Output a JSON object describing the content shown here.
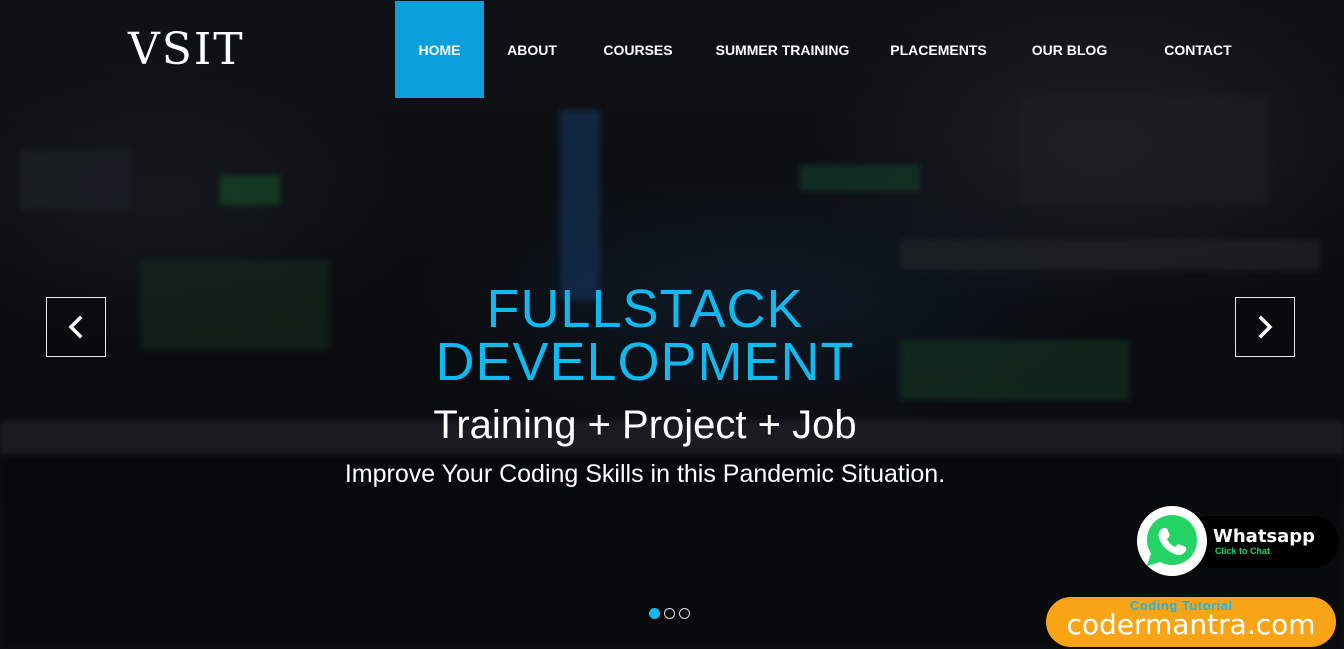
{
  "brand": {
    "logo_text": "VSIT"
  },
  "nav": {
    "items": [
      {
        "label": "HOME",
        "active": true
      },
      {
        "label": "ABOUT",
        "active": false
      },
      {
        "label": "COURSES",
        "active": false
      },
      {
        "label": "SUMMER TRAINING",
        "active": false
      },
      {
        "label": "PLACEMENTS",
        "active": false
      },
      {
        "label": "OUR BLOG",
        "active": false
      },
      {
        "label": "CONTACT",
        "active": false
      }
    ]
  },
  "slider": {
    "headline_line1": "FULLSTACK",
    "headline_line2": "DEVELOPMENT",
    "subheading": "Training + Project + Job",
    "tagline": "Improve Your Coding Skills in this Pandemic Situation.",
    "prev_icon": "chevron-left-icon",
    "next_icon": "chevron-right-icon",
    "slide_count": 3,
    "active_slide": 1
  },
  "whatsapp_widget": {
    "title": "Whatsapp",
    "subtitle": "Click to Chat",
    "icon": "whatsapp-icon"
  },
  "watermark": {
    "tag": "Coding Tutorial",
    "url": "codermantra.com"
  },
  "colors": {
    "accent": "#0ba0dc",
    "headline": "#10b9ef",
    "whatsapp_green": "#25d366",
    "watermark_orange": "#f8a414"
  }
}
